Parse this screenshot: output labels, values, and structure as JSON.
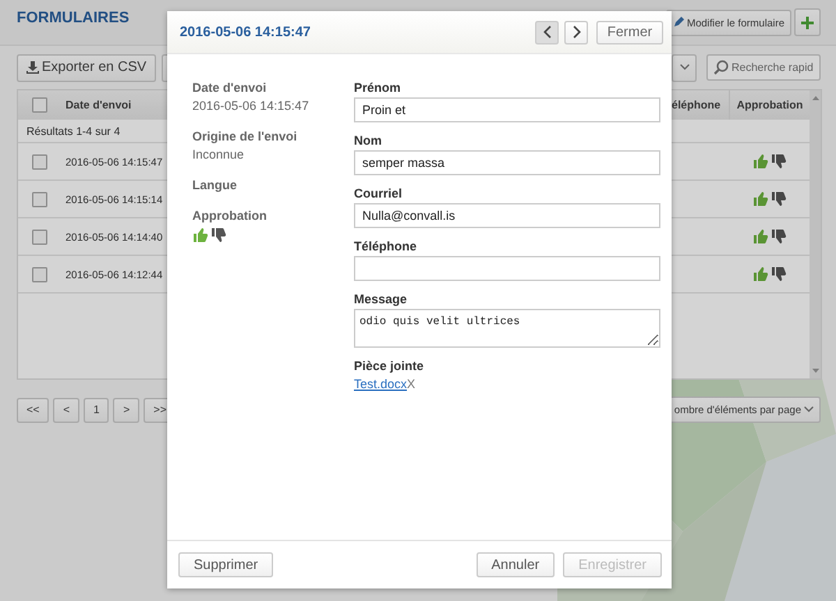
{
  "page": {
    "title": "FORMULAIRES",
    "edit_button": "Modifier le formulaire",
    "export_button": "Exporter en CSV",
    "search": {
      "placeholder": "Recherche rapid"
    },
    "table": {
      "all_checked": false,
      "columns": [
        "Date d'envoi",
        "éléphone",
        "Approbation"
      ],
      "summary": "Résultats 1-4 sur 4",
      "rows": [
        {
          "checked": false,
          "date": "2016-05-06 14:15:47",
          "approved": true
        },
        {
          "checked": false,
          "date": "2016-05-06 14:15:14",
          "approved": true
        },
        {
          "checked": false,
          "date": "2016-05-06 14:14:40",
          "approved": true
        },
        {
          "checked": false,
          "date": "2016-05-06 14:12:44",
          "approved": true
        }
      ]
    },
    "pagination": [
      {
        "label": "<<"
      },
      {
        "label": "<"
      },
      {
        "label": "1"
      },
      {
        "label": ">"
      },
      {
        "label": ">>"
      }
    ],
    "per_page": "ombre d'éléments par page"
  },
  "dialog": {
    "title": "2016-05-06 14:15:47",
    "nav": [
      {
        "kind": "prev",
        "disabled": true
      },
      {
        "kind": "next",
        "disabled": false
      }
    ],
    "close_button": "Fermer",
    "meta": [
      {
        "kind": "text",
        "label": "Date d'envoi",
        "value": "2016-05-06 14:15:47"
      },
      {
        "kind": "text",
        "label": "Origine de l'envoi",
        "value": "Inconnue"
      },
      {
        "kind": "text",
        "label": "Langue"
      },
      {
        "kind": "approval",
        "label": "Approbation",
        "approved": true
      }
    ],
    "fields": [
      {
        "kind": "text",
        "label": "Prénom",
        "value": "Proin et"
      },
      {
        "kind": "text",
        "label": "Nom",
        "value": "semper massa"
      },
      {
        "kind": "text",
        "label": "Courriel",
        "value": "Nulla@convall.is"
      },
      {
        "kind": "text",
        "label": "Téléphone"
      },
      {
        "kind": "textarea",
        "label": "Message",
        "value": "odio quis velit ultrices"
      },
      {
        "kind": "attachment",
        "label": "Pièce jointe",
        "file": "Test.docx",
        "remove": "X"
      }
    ],
    "footer": {
      "delete_button": "Supprimer",
      "cancel_button": "Annuler",
      "save_button": {
        "label": "Enregistrer",
        "disabled": true
      }
    }
  }
}
